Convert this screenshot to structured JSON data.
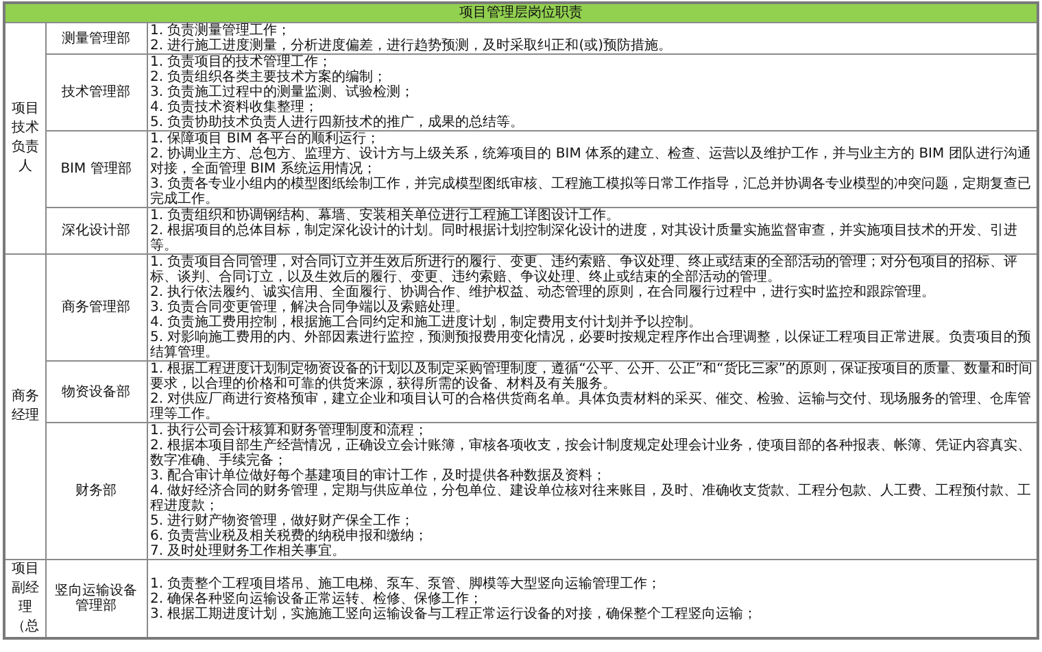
{
  "title": "项目管理层岗位职责",
  "groups": [
    {
      "role": "项目技术负责人",
      "departments": [
        {
          "name": "测量管理部",
          "duties": [
            "1. 负责测量管理工作；",
            "2. 进行施工进度测量，分析进度偏差，进行趋势预测，及时采取纠正和(或)预防措施。"
          ]
        },
        {
          "name": "技术管理部",
          "duties": [
            "1. 负责项目的技术管理工作；",
            "2. 负责组织各类主要技术方案的编制；",
            "3. 负责施工过程中的测量监测、试验检测；",
            "4. 负责技术资料收集整理；",
            "5. 负责协助技术负责人进行四新技术的推广，成果的总结等。"
          ]
        },
        {
          "name": "BIM 管理部",
          "duties": [
            "1. 保障项目 BIM 各平台的顺利运行；",
            "2. 协调业主方、总包方、监理方、设计方与上级关系，统筹项目的 BIM 体系的建立、检查、运营以及维护工作，并与业主方的 BIM 团队进行沟通对接，全面管理 BIM 系统运用情况；",
            "3. 负责各专业小组内的模型图纸绘制工作，并完成模型图纸审核、工程施工模拟等日常工作指导，汇总并协调各专业模型的冲突问题，定期复查已完成工作。"
          ]
        },
        {
          "name": "深化设计部",
          "duties": [
            "1. 负责组织和协调钢结构、幕墙、安装相关单位进行工程施工详图设计工作。",
            "2. 根据项目的总体目标，制定深化设计的计划。同时根据计划控制深化设计的进度，对其设计质量实施监督审查，并实施项目技术的开发、引进等。"
          ]
        }
      ]
    },
    {
      "role": "商务经理",
      "departments": [
        {
          "name": "商务管理部",
          "duties": [
            "1. 负责项目合同管理，对合同订立并生效后所进行的履行、变更、违约索赔、争议处理、终止或结束的全部活动的管理；对分包项目的招标、评标、谈判、合同订立，以及生效后的履行、变更、违约索赔、争议处理、终止或结束的全部活动的管理。",
            "2. 执行依法履约、诚实信用、全面履行、协调合作、维护权益、动态管理的原则，在合同履行过程中，进行实时监控和跟踪管理。",
            "3. 负责合同变更管理，解决合同争端以及索赔处理。",
            "4. 负责施工费用控制，根据施工合同约定和施工进度计划，制定费用支付计划并予以控制。",
            "5. 对影响施工费用的内、外部因素进行监控，预测预报费用变化情况，必要时按规定程序作出合理调整，以保证工程项目正常进展。负责项目的预结算管理。"
          ]
        },
        {
          "name": "物资设备部",
          "duties": [
            "1. 根据工程进度计划制定物资设备的计划以及制定采购管理制度，遵循“公平、公开、公正”和“货比三家”的原则，保证按项目的质量、数量和时间要求，以合理的价格和可靠的供货来源，获得所需的设备、材料及有关服务。",
            "2. 对供应厂商进行资格预审，建立企业和项目认可的合格供货商名单。具体负责材料的采买、催交、检验、运输与交付、现场服务的管理、仓库管理等工作。"
          ]
        },
        {
          "name": "财务部",
          "duties": [
            "1. 执行公司会计核算和财务管理制度和流程；",
            "2. 根据本项目部生产经营情况，正确设立会计账簿，审核各项收支，按会计制度规定处理会计业务，使项目部的各种报表、帐簿、凭证内容真实、数字准确、手续完备；",
            "3. 配合审计单位做好每个基建项目的审计工作，及时提供各种数据及资料；",
            "4. 做好经济合同的财务管理，定期与供应单位，分包单位、建设单位核对往来账目，及时、准确收支货款、工程分包款、人工费、工程预付款、工程进度款；",
            "5. 进行财产物资管理，做好财产保全工作；",
            "6. 负责营业税及相关税费的纳税申报和缴纳；",
            "7. 及时处理财务工作相关事宜。"
          ]
        }
      ]
    },
    {
      "role": "项目副经理（总",
      "departments": [
        {
          "name": "竖向运输设备管理部",
          "duties": [
            "1. 负责整个工程项目塔吊、施工电梯、泵车、泵管、脚模等大型竖向运输管理工作；",
            "2. 确保各种竖向运输设备正常运转、检修、保修工作；",
            "3. 根据工期进度计划，实施施工竖向运输设备与工程正常运行设备的对接，确保整个工程竖向运输；"
          ]
        }
      ]
    }
  ]
}
